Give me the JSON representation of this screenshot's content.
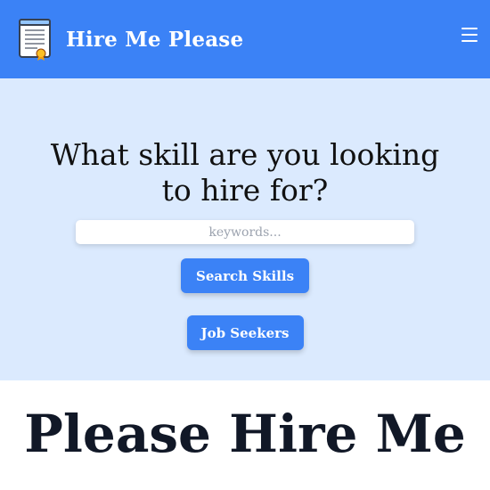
{
  "navbar": {
    "brand": "Hire Me Please",
    "logo_icon": "certificate-icon",
    "menu_icon": "hamburger-menu-icon",
    "background": "#3b82f6"
  },
  "hero": {
    "title": "What skill are you looking to hire for?",
    "search": {
      "placeholder": "keywords...",
      "value": ""
    },
    "search_button_label": "Search Skills",
    "job_seekers_button_label": "Job Seekers",
    "background": "#dbeafe"
  },
  "main": {
    "heading": "Please Hire Me"
  }
}
